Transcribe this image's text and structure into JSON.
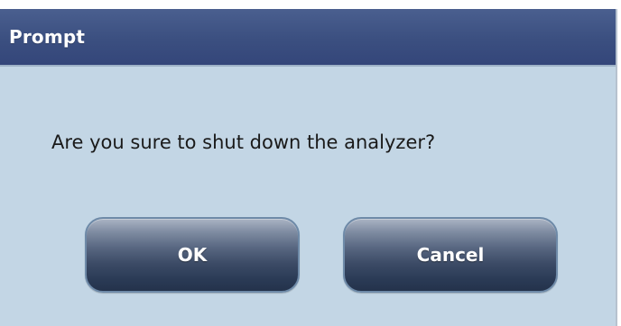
{
  "dialog": {
    "title": "Prompt",
    "message": "Are you sure to shut down the analyzer?",
    "buttons": {
      "ok_label": "OK",
      "cancel_label": "Cancel"
    }
  },
  "colors": {
    "titlebar": "#3b4f80",
    "dialog_background": "#c3d6e5",
    "button": "#3c4b66",
    "button_text": "#ffffff"
  }
}
